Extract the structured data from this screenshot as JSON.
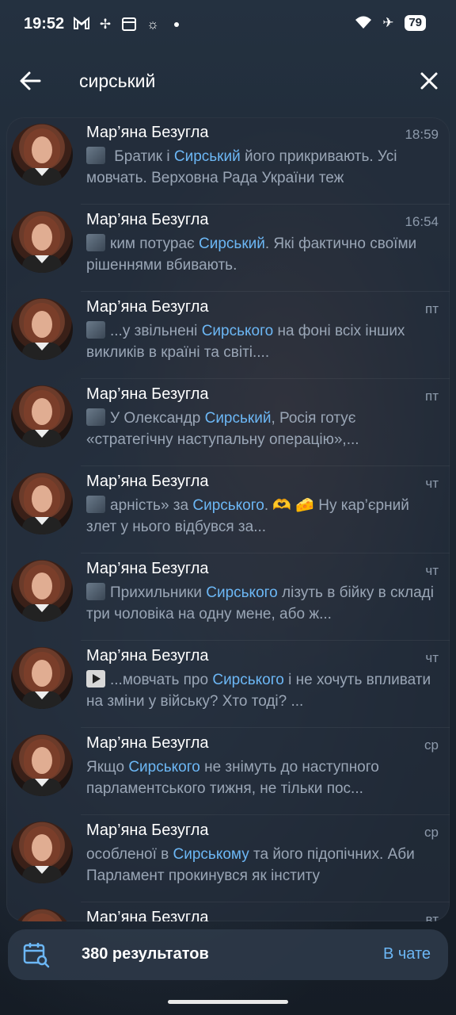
{
  "status_bar": {
    "time": "19:52",
    "battery": "79"
  },
  "search": {
    "query": "сирський"
  },
  "results": [
    {
      "name": "Мар’яна Безугла",
      "date": "18:59",
      "thumb": "photo",
      "snippet": [
        {
          "t": "  Братик і "
        },
        {
          "t": "Сирський",
          "hl": true
        },
        {
          "t": " його прикривають. Усі мовчать. Верховна Рада України теж"
        }
      ]
    },
    {
      "name": "Мар’яна Безугла",
      "date": "16:54",
      "thumb": "photo",
      "snippet": [
        {
          "t": "ким потурає "
        },
        {
          "t": "Сирський",
          "hl": true
        },
        {
          "t": ". Які фактично своїми рішеннями вбивають."
        }
      ]
    },
    {
      "name": "Мар’яна Безугла",
      "date": "пт",
      "thumb": "photo",
      "snippet": [
        {
          "t": "...у звільнені "
        },
        {
          "t": "Сирського",
          "hl": true
        },
        {
          "t": " на фоні всіх інших викликів в країні та світі...."
        }
      ]
    },
    {
      "name": "Мар’яна Безугла",
      "date": "пт",
      "thumb": "photo",
      "snippet": [
        {
          "t": "У Олександр "
        },
        {
          "t": "Сирський",
          "hl": true
        },
        {
          "t": ", Росія готує «стратегічну наступальну операцію»,..."
        }
      ]
    },
    {
      "name": "Мар’яна Безугла",
      "date": "чт",
      "thumb": "photo",
      "snippet": [
        {
          "t": "арність» за "
        },
        {
          "t": "Сирського",
          "hl": true
        },
        {
          "t": ". 🫶 🧀 Ну кар’єрний злет у нього відбувся за..."
        }
      ]
    },
    {
      "name": "Мар’яна Безугла",
      "date": "чт",
      "thumb": "photo",
      "snippet": [
        {
          "t": "Прихильники "
        },
        {
          "t": "Сирського",
          "hl": true
        },
        {
          "t": " лізуть в бійку в складі три чоловіка на одну мене, або ж..."
        }
      ]
    },
    {
      "name": "Мар’яна Безугла",
      "date": "чт",
      "thumb": "video",
      "snippet": [
        {
          "t": "...мовчать про "
        },
        {
          "t": "Сирського",
          "hl": true
        },
        {
          "t": " і не хочуть впливати на зміни у війську? Хто тоді? ..."
        }
      ]
    },
    {
      "name": "Мар’яна Безугла",
      "date": "ср",
      "thumb": "none",
      "snippet": [
        {
          "t": "Якщо "
        },
        {
          "t": "Сирського",
          "hl": true
        },
        {
          "t": " не знімуть до наступного парламентського тижня, не тільки пос..."
        }
      ]
    },
    {
      "name": "Мар’яна Безугла",
      "date": "ср",
      "thumb": "none",
      "snippet": [
        {
          "t": "особленої в "
        },
        {
          "t": "Сирському",
          "hl": true
        },
        {
          "t": " та його підопічних. Аби Парламент прокинувся як інститу"
        }
      ]
    },
    {
      "name": "Мар’яна Безугла",
      "date": "вт",
      "thumb": "none",
      "snippet": [
        {
          "t": ""
        }
      ]
    }
  ],
  "bottom_bar": {
    "count": "380 результатов",
    "in_chat": "В чате"
  },
  "colors": {
    "accent": "#6cb7f5",
    "background": "#1d2733"
  }
}
